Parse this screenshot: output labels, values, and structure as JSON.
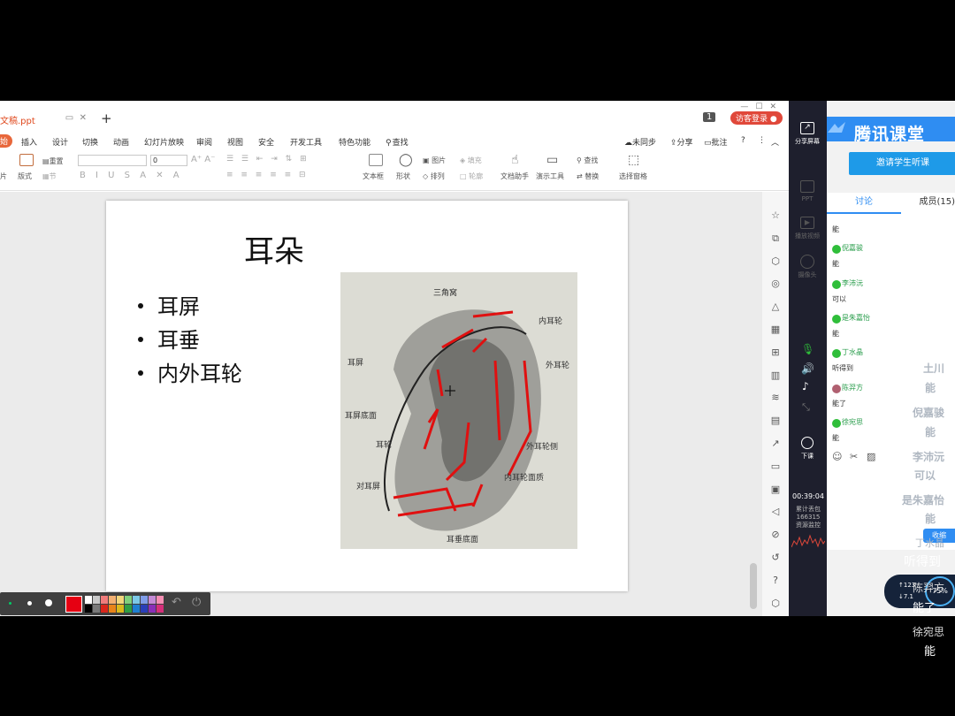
{
  "wps": {
    "doc_tab_title": "文稿.ppt",
    "new_tab": "+",
    "page_counter": "1",
    "visitor_login": "访客登录",
    "menu": [
      {
        "label": "始",
        "active": true
      },
      {
        "label": "插入"
      },
      {
        "label": "设计"
      },
      {
        "label": "切换"
      },
      {
        "label": "动画"
      },
      {
        "label": "幻灯片放映"
      },
      {
        "label": "审阅"
      },
      {
        "label": "视图"
      },
      {
        "label": "安全"
      },
      {
        "label": "开发工具"
      },
      {
        "label": "特色功能"
      },
      {
        "label": "查找"
      }
    ],
    "menu_right": {
      "sync": "未同步",
      "share": "分享",
      "comment": "批注"
    },
    "ribbon": {
      "layout": "片",
      "reset": "重置",
      "format": "版式",
      "section": "节",
      "font_size": "0",
      "textbox": "文本框",
      "shape": "形状",
      "picture": "图片",
      "fill": "填充",
      "arrange": "排列",
      "outline": "轮廓",
      "doc_assistant": "文档助手",
      "present_tools": "演示工具",
      "find": "查找",
      "replace": "替换",
      "select_pane": "选择窗格"
    }
  },
  "slide": {
    "title": "耳朵",
    "bullets": [
      "耳屏",
      "耳垂",
      "内外耳轮"
    ],
    "sketch_labels": [
      "三角窝",
      "内耳轮",
      "耳屏",
      "外耳轮",
      "耳屏底面",
      "外耳轮侧",
      "内耳轮面质",
      "耳垂底面",
      "对耳屏",
      "耳轮"
    ]
  },
  "drawbar": {
    "colors": [
      "#ffffff",
      "#c9c9c9",
      "#f07c7c",
      "#f3b072",
      "#f2d67d",
      "#80d07c",
      "#7cc9e8",
      "#7f9ce8",
      "#c48ad6",
      "#f58fb4",
      "#000000",
      "#7a7a7a",
      "#d9261c",
      "#e8841a",
      "#d9b91c",
      "#2f9e44",
      "#1f7fd1",
      "#2a3fb8",
      "#8a2fb8",
      "#d62f7a"
    ],
    "selected_color": "#e60012"
  },
  "tencent": {
    "brand": "腾讯课堂",
    "invite_button": "邀请学生听课",
    "tabs": {
      "discussion": "讨论",
      "members": "成员(15)"
    },
    "left_menu": [
      "分享屏幕",
      "PPT",
      "播放视频",
      "摄像头"
    ],
    "end_class": "下课",
    "timer": "00:39:04",
    "stats": [
      "累计丢包",
      "166315",
      "资源监控"
    ],
    "chat": [
      {
        "name": "",
        "msg": "能"
      },
      {
        "name": "倪嘉骏",
        "msg": "能"
      },
      {
        "name": "李沛沅",
        "msg": "可以"
      },
      {
        "name": "是朱嘉怡",
        "msg": "能"
      },
      {
        "name": "丁水晶",
        "msg": "听得到"
      },
      {
        "name": "陈羿方",
        "msg": "能了"
      },
      {
        "name": "徐宛思",
        "msg": "能"
      }
    ],
    "overlay": [
      {
        "name": "土川",
        "msg": "能"
      },
      {
        "name": "倪嘉骏",
        "msg": "能"
      },
      {
        "name": "李沛沅",
        "msg": "可以"
      },
      {
        "name": "是朱嘉怡",
        "msg": "能"
      },
      {
        "name": "丁水晶",
        "msg": "听得到"
      },
      {
        "name": "陈羿方",
        "msg": "能了"
      },
      {
        "name": "徐宛思",
        "msg": "能"
      }
    ],
    "speed": {
      "up": "123",
      "down": "7.1",
      "percent": "75%"
    },
    "collapse": "收缩"
  }
}
